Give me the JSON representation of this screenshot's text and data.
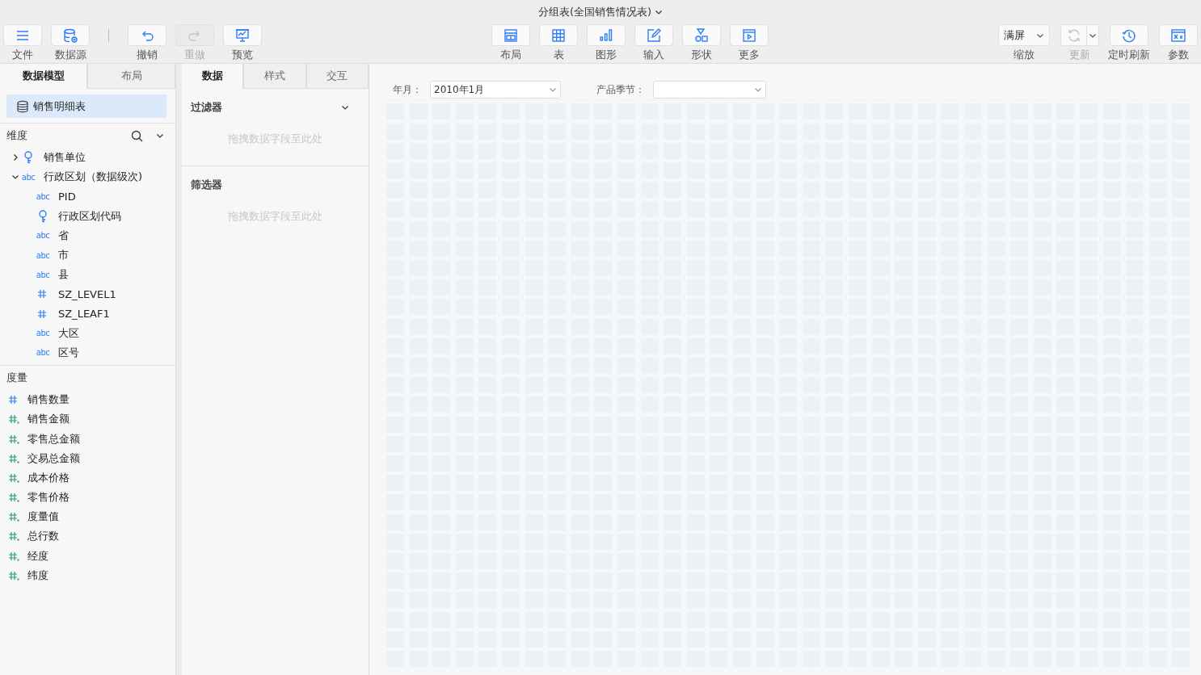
{
  "title": "分组表(全国销售情况表)",
  "toolbar_left": [
    {
      "label": "文件",
      "kind": "menu",
      "disabled": false
    },
    {
      "label": "数据源",
      "kind": "database",
      "disabled": false
    },
    {
      "kind": "separator"
    },
    {
      "label": "撤销",
      "kind": "undo",
      "disabled": false
    },
    {
      "label": "重做",
      "kind": "redo",
      "disabled": true
    },
    {
      "label": "预览",
      "kind": "preview",
      "disabled": false
    }
  ],
  "toolbar_center": [
    {
      "label": "布局",
      "kind": "layout",
      "disabled": false
    },
    {
      "label": "表",
      "kind": "table",
      "disabled": false
    },
    {
      "label": "图形",
      "kind": "chart",
      "disabled": false
    },
    {
      "label": "输入",
      "kind": "edit",
      "disabled": false
    },
    {
      "label": "形状",
      "kind": "shapes",
      "disabled": false
    },
    {
      "label": "更多",
      "kind": "more",
      "disabled": false
    }
  ],
  "toolbar_right": [
    {
      "label": "缩放",
      "kind": "zoom",
      "value": "满屏"
    },
    {
      "label": "更新",
      "kind": "refresh",
      "disabled": true
    },
    {
      "label": "定时刷新",
      "kind": "timer",
      "disabled": false
    },
    {
      "label": "参数",
      "kind": "params",
      "disabled": false
    }
  ],
  "left_tabs": [
    {
      "label": "数据模型",
      "selected": true
    },
    {
      "label": "布局",
      "selected": false
    }
  ],
  "dataset": {
    "name": "销售明细表",
    "selected": true
  },
  "dimensions": {
    "title": "维度",
    "items": [
      {
        "name": "销售单位",
        "kind": "key",
        "expanded": false
      },
      {
        "name": "行政区划（数据级次)",
        "kind": "text",
        "icon_text": "abc",
        "expanded": true,
        "children": [
          {
            "name": "PID",
            "kind": "text",
            "icon_text": "abc"
          },
          {
            "name": "行政区划代码",
            "kind": "key"
          },
          {
            "name": "省",
            "kind": "text",
            "icon_text": "abc"
          },
          {
            "name": "市",
            "kind": "text",
            "icon_text": "abc"
          },
          {
            "name": "县",
            "kind": "text",
            "icon_text": "abc"
          },
          {
            "name": "SZ_LEVEL1",
            "kind": "number"
          },
          {
            "name": "SZ_LEAF1",
            "kind": "number"
          },
          {
            "name": "大区",
            "kind": "text",
            "icon_text": "abc"
          },
          {
            "name": "区号",
            "kind": "text",
            "icon_text": "abc"
          }
        ]
      }
    ]
  },
  "measures": {
    "title": "度量",
    "items": [
      {
        "name": "销售数量",
        "kind": "number"
      },
      {
        "name": "销售金额",
        "kind": "measure"
      },
      {
        "name": "零售总金额",
        "kind": "measure"
      },
      {
        "name": "交易总金额",
        "kind": "measure"
      },
      {
        "name": "成本价格",
        "kind": "measure"
      },
      {
        "name": "零售价格",
        "kind": "measure"
      },
      {
        "name": "度量值",
        "kind": "measure"
      },
      {
        "name": "总行数",
        "kind": "measure"
      },
      {
        "name": "经度",
        "kind": "measure"
      },
      {
        "name": "纬度",
        "kind": "measure"
      }
    ]
  },
  "middle_tabs": [
    {
      "label": "数据",
      "selected": true
    },
    {
      "label": "样式",
      "selected": false
    },
    {
      "label": "交互",
      "selected": false
    }
  ],
  "sections": [
    {
      "title": "过滤器",
      "expanded": true,
      "placeholder": "拖拽数据字段至此处"
    },
    {
      "title": "筛选器",
      "placeholder": "拖拽数据字段至此处"
    }
  ],
  "canvas_filters": [
    {
      "label": "年月：",
      "value": "2010年1月"
    },
    {
      "label": "产品季节："
    }
  ]
}
